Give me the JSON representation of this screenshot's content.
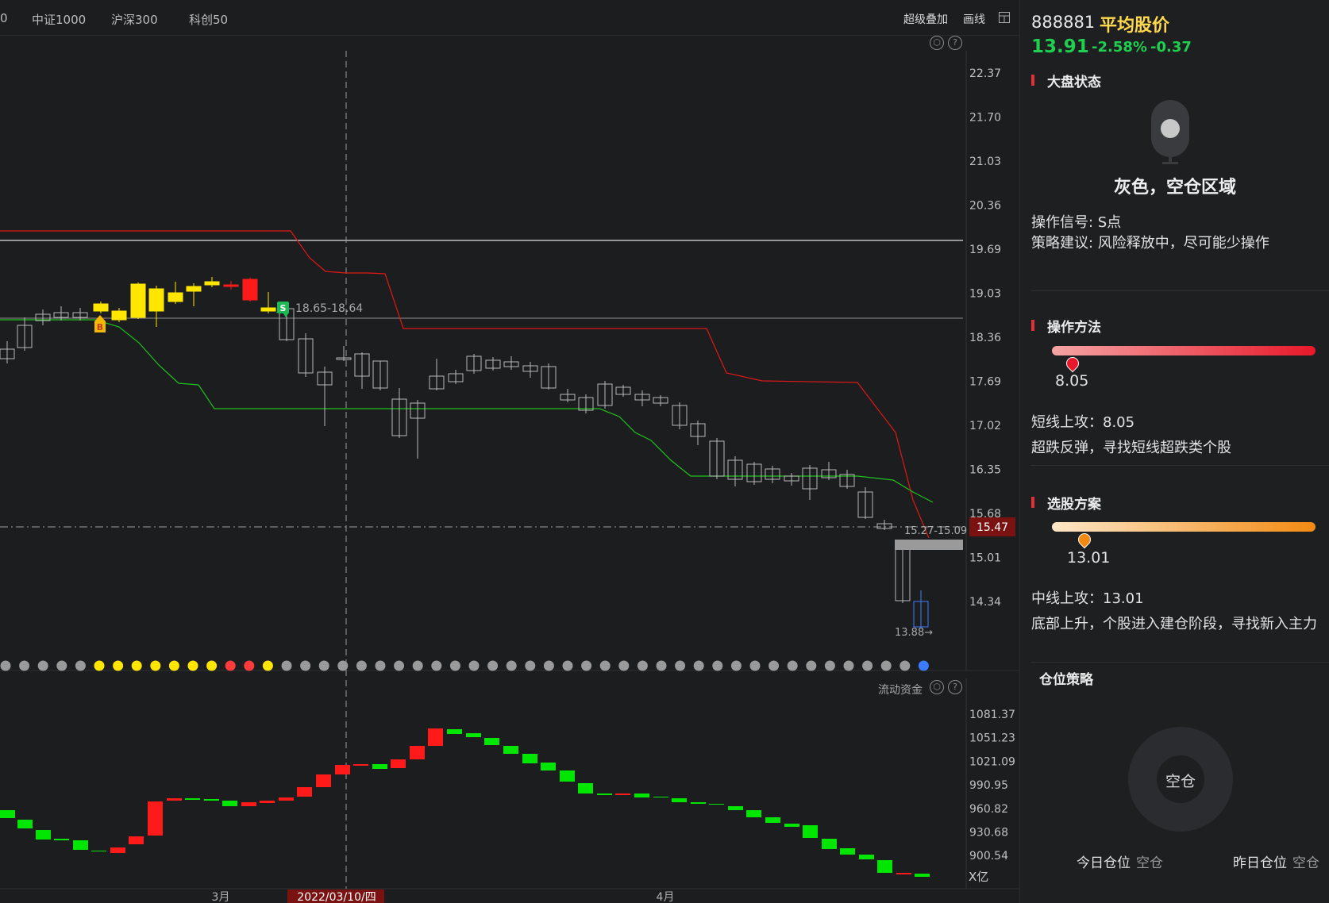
{
  "topbar": {
    "tabs": [
      "0",
      "中证1000",
      "沪深300",
      "科创50"
    ],
    "super_overlay": "超级叠加",
    "draw": "画线"
  },
  "main_chart": {
    "price_axis": [
      "22.37",
      "21.70",
      "21.03",
      "20.36",
      "19.69",
      "19.03",
      "18.36",
      "17.69",
      "17.02",
      "16.35",
      "15.68",
      "15.01",
      "14.34"
    ],
    "sell_label": "18.65-18.64",
    "buy_marker": "B",
    "sell_marker": "S",
    "range_label": "15.27-15.09",
    "current_price_tag": "15.47",
    "low_label": "13.88→"
  },
  "volume_chart": {
    "title": "流动资金",
    "axis": [
      "1081.37",
      "1051.23",
      "1021.09",
      "990.95",
      "960.82",
      "930.68",
      "900.54"
    ],
    "unit": "X亿"
  },
  "time_axis": {
    "march": "3月",
    "april": "4月",
    "cursor_date": "2022/03/10/四"
  },
  "panel": {
    "code": "888881",
    "name": "平均股价",
    "price": "13.91",
    "pct": "-2.58%",
    "change": "-0.37",
    "market_state": {
      "title": "大盘状态",
      "zone": "灰色，空仓区域",
      "signal": "操作信号: S点",
      "advice": "策略建议: 风险释放中，尽可能少操作"
    },
    "method": {
      "title": "操作方法",
      "value": "8.05",
      "line1": "短线上攻：8.05",
      "line2": "超跌反弹，寻找短线超跌类个股"
    },
    "stock_plan": {
      "title": "选股方案",
      "value": "13.01",
      "line1": "中线上攻：13.01",
      "line2": "底部上升，个股进入建仓阶段，寻找新入主力"
    },
    "position": {
      "title": "仓位策略",
      "center": "空仓",
      "today_label": "今日仓位",
      "today_value": "空仓",
      "yesterday_label": "昨日仓位",
      "yesterday_value": "空仓"
    }
  },
  "colors": {
    "up": "#ff1a1a",
    "down": "#00e600",
    "price_green": "#1fcf4f",
    "name_yellow": "#ffd84d",
    "bg": "#1c1d1f"
  }
}
